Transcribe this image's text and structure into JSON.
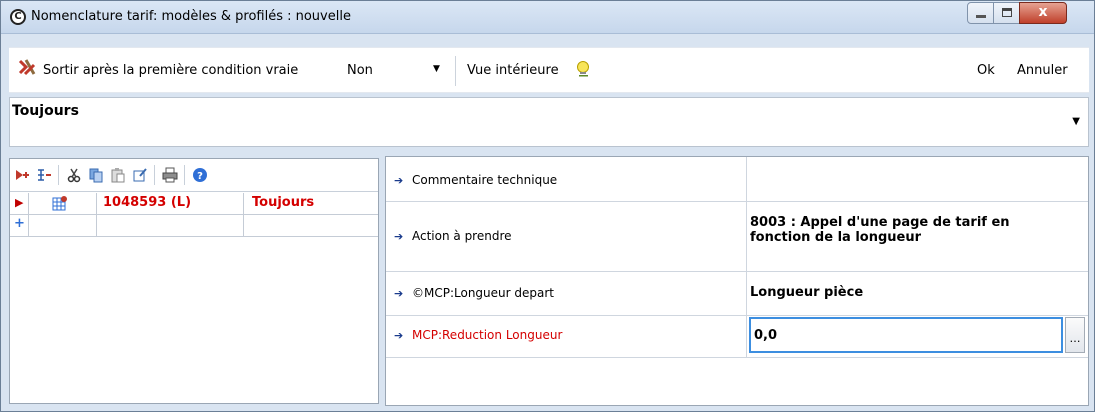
{
  "window": {
    "title": "Nomenclature tarif: modèles & profilés : nouvelle",
    "app_icon": "circled-c-icon",
    "close_glyph": "x"
  },
  "toolbar": {
    "exit_label": "Sortir après la première condition vraie",
    "exit_value": "Non",
    "view_label": "Vue intérieure",
    "ok_label": "Ok",
    "cancel_label": "Annuler"
  },
  "condition": {
    "value": "Toujours"
  },
  "left_grid": {
    "icons": [
      "insert-row-icon",
      "indent-icon",
      "cut-icon",
      "copy-icon",
      "paste-icon",
      "edit-icon",
      "print-icon",
      "help-icon"
    ],
    "rows": [
      {
        "id": "1048593 (L)",
        "condition": "Toujours"
      }
    ]
  },
  "properties": [
    {
      "label": "Commentaire technique",
      "value": ""
    },
    {
      "label": "Action à prendre",
      "value": "8003 : Appel d'une page de tarif en fonction de la longueur"
    },
    {
      "label": "©MCP:Longueur depart",
      "value": "Longueur pièce"
    },
    {
      "label": "MCP:Reduction Longueur",
      "value": "0,0"
    }
  ],
  "colors": {
    "accent_red": "#d40000",
    "focus_blue": "#3c8ee0"
  }
}
